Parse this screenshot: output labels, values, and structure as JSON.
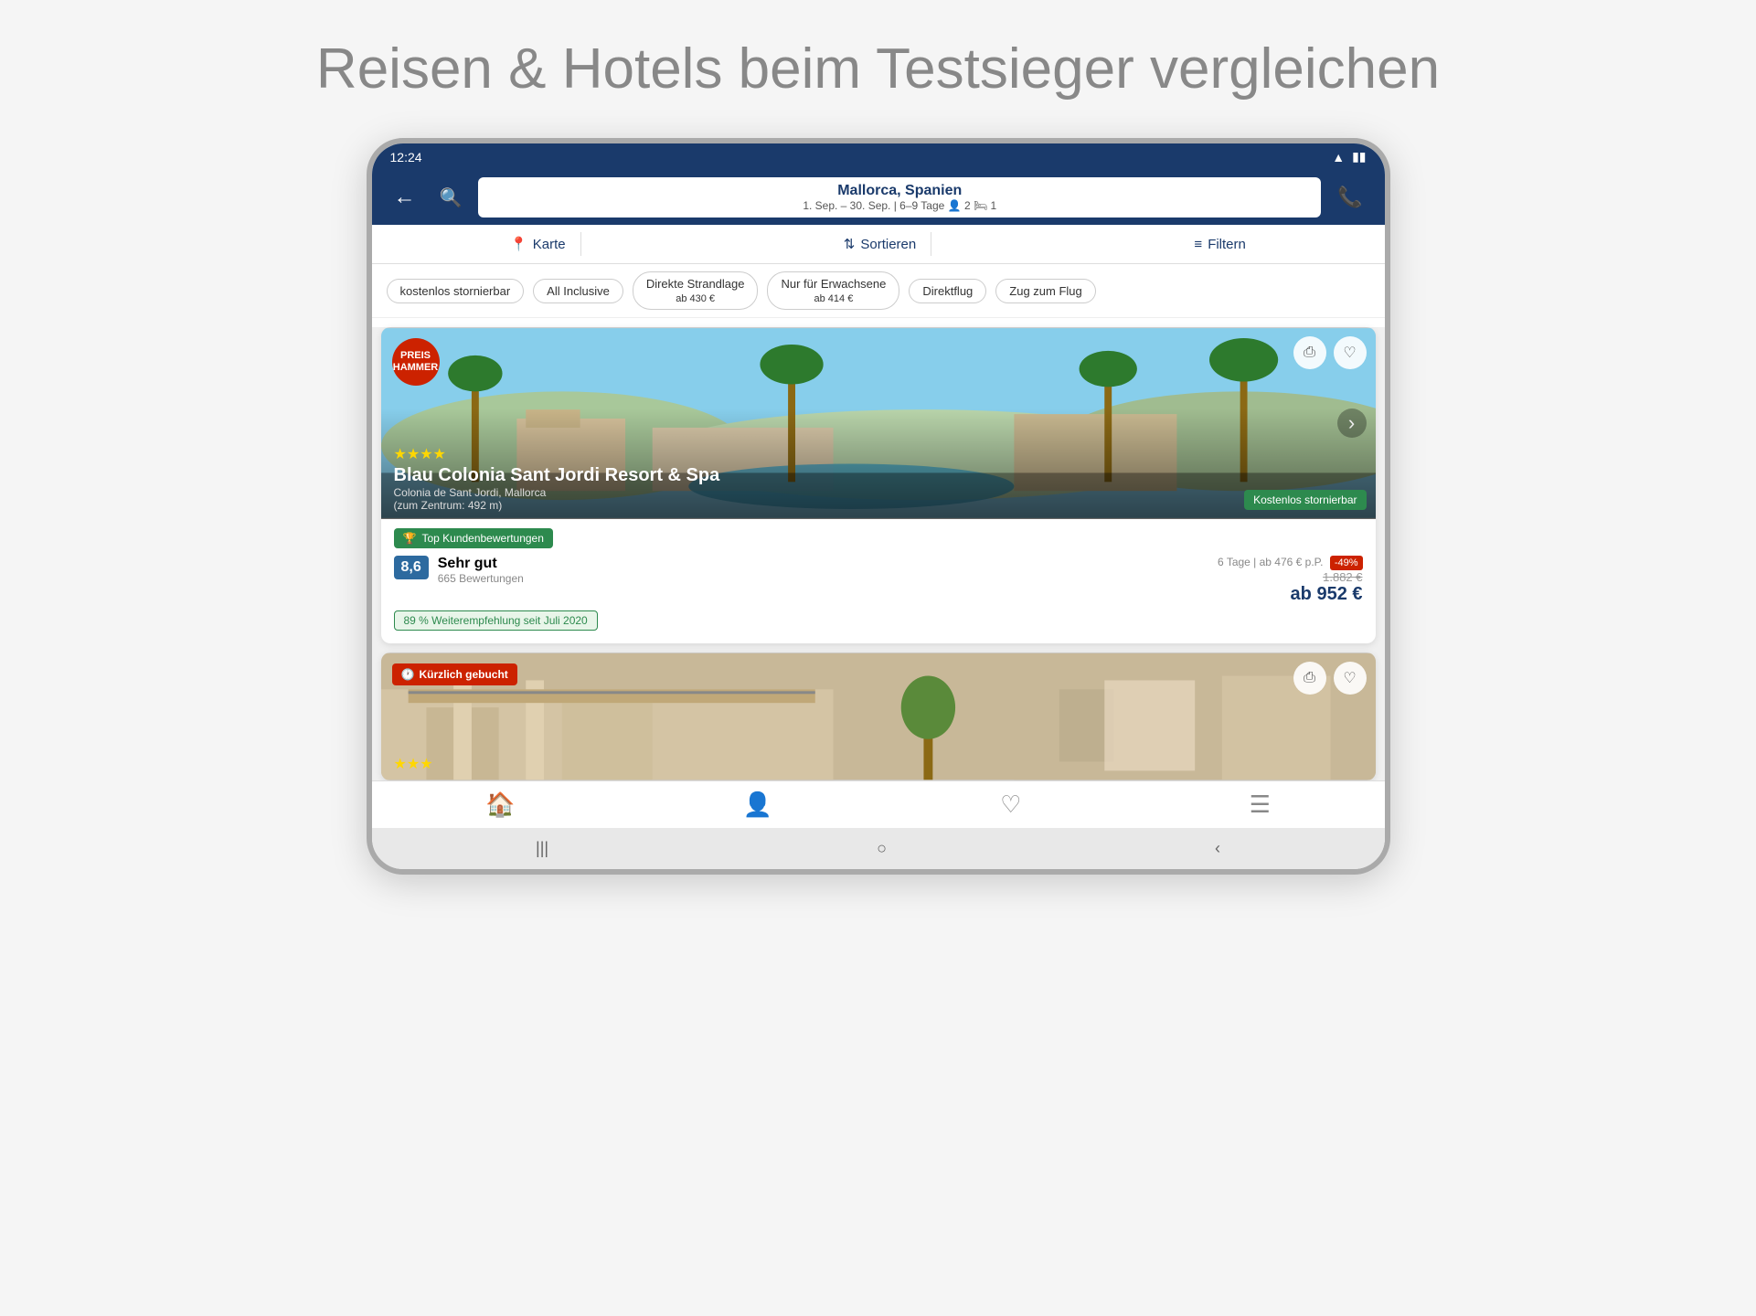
{
  "headline": "Reisen & Hotels beim Testsieger vergleichen",
  "status_bar": {
    "time": "12:24",
    "wifi": "wifi",
    "battery": "battery"
  },
  "nav": {
    "back_label": "←",
    "search_icon": "🔍",
    "destination_title": "Mallorca, Spanien",
    "destination_subtitle": "1. Sep. – 30. Sep. | 6–9 Tage  👤 2  🛏 1",
    "phone_icon": "📞"
  },
  "filter_bar": {
    "map_label": "Karte",
    "sort_label": "Sortieren",
    "filter_label": "Filtern"
  },
  "quick_filters": [
    {
      "label": "kostenlos stornierbar",
      "active": false
    },
    {
      "label": "All Inclusive",
      "active": false
    },
    {
      "label": "Direkte Strandlage ab 430 €",
      "active": false
    },
    {
      "label": "Nur für Erwachsene ab 414 €",
      "active": false
    },
    {
      "label": "Direktflug",
      "active": false
    },
    {
      "label": "Zug zum Flug",
      "active": false
    }
  ],
  "hotels": [
    {
      "id": 1,
      "badge_top": "PREIS HAMMER",
      "badge_type": "preis",
      "name": "Blau Colonia Sant Jordi Resort & Spa",
      "location": "Colonia de Sant Jordi, Mallorca",
      "location_sub": "(zum Zentrum: 492 m)",
      "stars": 4,
      "top_award": "Top Kundenbewertungen",
      "rating_score": "8,6",
      "rating_label": "Sehr gut",
      "rating_count": "665 Bewertungen",
      "recommendation": "89 % Weiterempfehlung seit Juli 2020",
      "stornierbar": "Kostenlos stornierbar",
      "price_days": "6 Tage | ab 476 € p.P.",
      "discount": "-49%",
      "old_price": "1.882 €",
      "new_price": "ab 952 €"
    },
    {
      "id": 2,
      "badge_top": "Kürzlich gebucht",
      "badge_type": "kurzlich",
      "name": "",
      "stars": 3,
      "show_partial": true
    }
  ],
  "bottom_nav": [
    {
      "icon": "🏠",
      "label": "home",
      "active": true
    },
    {
      "icon": "👤",
      "label": "account",
      "active": false
    },
    {
      "icon": "♡",
      "label": "favorites",
      "active": false
    },
    {
      "icon": "☰",
      "label": "menu",
      "active": false
    }
  ],
  "android_nav": {
    "recent": "|||",
    "home": "○",
    "back": "‹"
  }
}
